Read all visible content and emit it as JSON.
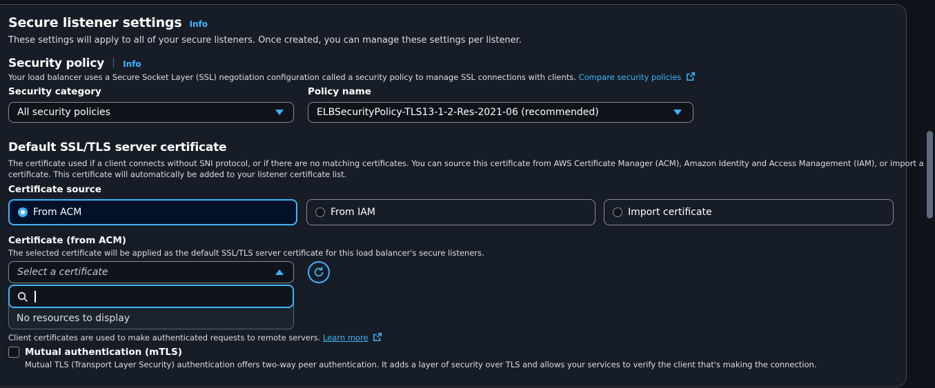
{
  "secure": {
    "title": "Secure listener settings",
    "info": "Info",
    "desc": "These settings will apply to all of your secure listeners. Once created, you can manage these settings per listener."
  },
  "policy": {
    "title": "Security policy",
    "info": "Info",
    "desc": "Your load balancer uses a Secure Socket Layer (SSL) negotiation configuration called a security policy to manage SSL connections with clients.",
    "compare_link": "Compare security policies",
    "category_label": "Security category",
    "category_value": "All security policies",
    "name_label": "Policy name",
    "name_value": "ELBSecurityPolicy-TLS13-1-2-Res-2021-06 (recommended)"
  },
  "cert": {
    "title": "Default SSL/TLS server certificate",
    "desc_line1": "The certificate used if a client connects without SNI protocol, or if there are no matching certificates. You can source this certificate from AWS Certificate Manager (ACM), Amazon Identity and Access Management (IAM), or import a",
    "desc_line2": "certificate. This certificate will automatically be added to your listener certificate list.",
    "source_label": "Certificate source",
    "options": [
      "From ACM",
      "From IAM",
      "Import certificate"
    ],
    "acm_label": "Certificate (from ACM)",
    "acm_desc": "The selected certificate will be applied as the default SSL/TLS server certificate for this load balancer's secure listeners.",
    "select_placeholder": "Select a certificate",
    "search_value": "",
    "empty_text": "No resources to display"
  },
  "client": {
    "desc": "Client certificates are used to make authenticated requests to remote servers.",
    "learn_more": "Learn more",
    "mtls_label": "Mutual authentication (mTLS)",
    "mtls_desc": "Mutual TLS (Transport Layer Security) authentication offers two-way peer authentication. It adds a layer of security over TLS and allows your services to verify the client that's making the connection.",
    "mtls_checked": false
  },
  "colors": {
    "accent": "#42b4ff",
    "panel": "#161d26",
    "background": "#0f141a"
  }
}
